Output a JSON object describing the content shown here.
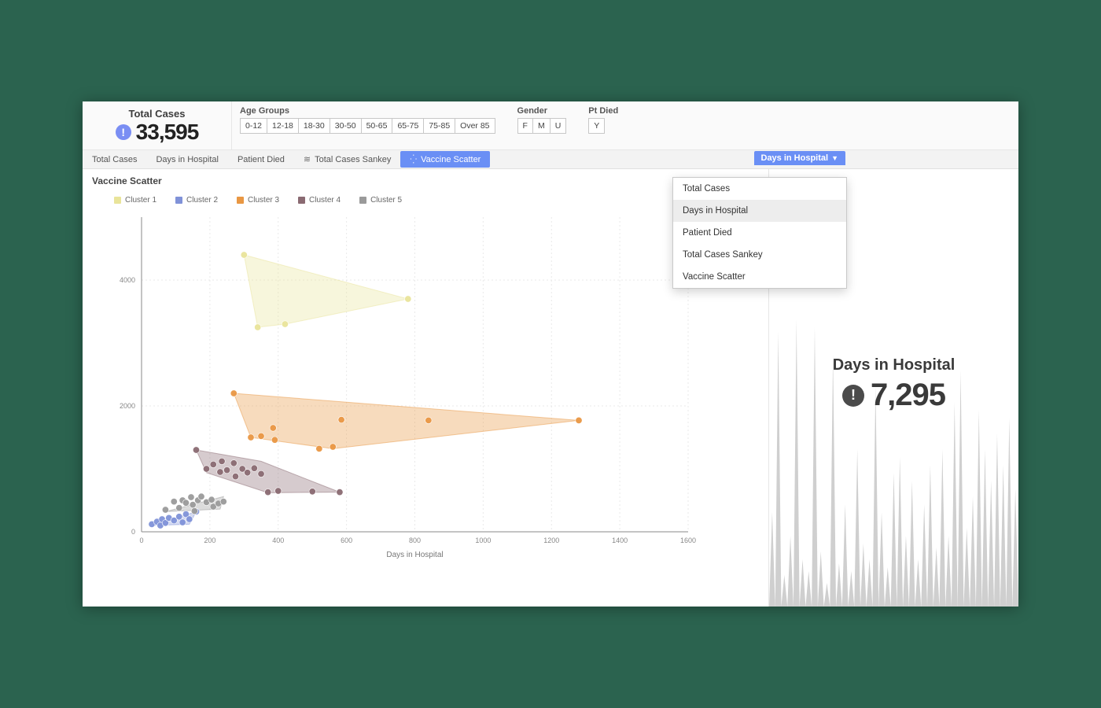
{
  "kpi_top": {
    "title": "Total Cases",
    "value": "33,595"
  },
  "filters": {
    "age_label": "Age Groups",
    "age_options": [
      "0-12",
      "12-18",
      "18-30",
      "30-50",
      "50-65",
      "65-75",
      "75-85",
      "Over 85"
    ],
    "gender_label": "Gender",
    "gender_options": [
      "F",
      "M",
      "U"
    ],
    "died_label": "Pt Died",
    "died_options": [
      "Y"
    ]
  },
  "tabs": {
    "items": [
      "Total Cases",
      "Days in Hospital",
      "Patient Died",
      "Total Cases Sankey",
      "Vaccine Scatter"
    ],
    "active_index": 4,
    "sankey_icon_index": 3,
    "scatter_icon_index": 4
  },
  "chart": {
    "title": "Vaccine Scatter",
    "xlabel": "Days in Hospital",
    "legend": [
      {
        "name": "Cluster 1",
        "color": "#e9e49a"
      },
      {
        "name": "Cluster 2",
        "color": "#8092d8"
      },
      {
        "name": "Cluster 3",
        "color": "#e99743"
      },
      {
        "name": "Cluster 4",
        "color": "#8a6a72"
      },
      {
        "name": "Cluster 5",
        "color": "#9a9a9a"
      }
    ]
  },
  "dropdown": {
    "button_label": "Days in Hospital",
    "items": [
      "Total Cases",
      "Days in Hospital",
      "Patient Died",
      "Total Cases Sankey",
      "Vaccine Scatter"
    ],
    "selected_index": 1
  },
  "side_kpi": {
    "title": "Days in Hospital",
    "value": "7,295"
  },
  "chart_data": {
    "type": "scatter",
    "title": "Vaccine Scatter",
    "xlabel": "Days in Hospital",
    "ylabel": "",
    "xlim": [
      0,
      1600
    ],
    "ylim": [
      0,
      5000
    ],
    "xticks": [
      0,
      200,
      400,
      600,
      800,
      1000,
      1200,
      1400,
      1600
    ],
    "yticks": [
      0,
      2000,
      4000
    ],
    "series": [
      {
        "name": "Cluster 1",
        "color": "#e9e49a",
        "points": [
          [
            300,
            4400
          ],
          [
            340,
            3250
          ],
          [
            420,
            3300
          ],
          [
            780,
            3700
          ]
        ],
        "hull": [
          [
            300,
            4400
          ],
          [
            780,
            3700
          ],
          [
            420,
            3300
          ],
          [
            340,
            3250
          ]
        ]
      },
      {
        "name": "Cluster 2",
        "color": "#8092d8",
        "points": [
          [
            30,
            120
          ],
          [
            45,
            160
          ],
          [
            55,
            100
          ],
          [
            60,
            200
          ],
          [
            70,
            140
          ],
          [
            80,
            220
          ],
          [
            95,
            180
          ],
          [
            110,
            240
          ],
          [
            120,
            150
          ],
          [
            130,
            280
          ],
          [
            140,
            200
          ],
          [
            160,
            320
          ]
        ],
        "hull": [
          [
            30,
            100
          ],
          [
            160,
            320
          ],
          [
            140,
            120
          ]
        ]
      },
      {
        "name": "Cluster 3",
        "color": "#e99743",
        "points": [
          [
            270,
            2200
          ],
          [
            320,
            1500
          ],
          [
            350,
            1520
          ],
          [
            385,
            1650
          ],
          [
            390,
            1460
          ],
          [
            520,
            1320
          ],
          [
            560,
            1350
          ],
          [
            585,
            1780
          ],
          [
            840,
            1770
          ],
          [
            1280,
            1770
          ]
        ],
        "hull": [
          [
            270,
            2200
          ],
          [
            1280,
            1770
          ],
          [
            560,
            1320
          ],
          [
            320,
            1500
          ]
        ]
      },
      {
        "name": "Cluster 4",
        "color": "#8a6a72",
        "points": [
          [
            160,
            1300
          ],
          [
            190,
            1000
          ],
          [
            210,
            1070
          ],
          [
            230,
            950
          ],
          [
            235,
            1120
          ],
          [
            250,
            980
          ],
          [
            270,
            1090
          ],
          [
            275,
            880
          ],
          [
            295,
            1000
          ],
          [
            310,
            940
          ],
          [
            330,
            1010
          ],
          [
            350,
            920
          ],
          [
            370,
            630
          ],
          [
            400,
            650
          ],
          [
            500,
            640
          ],
          [
            580,
            630
          ]
        ],
        "hull": [
          [
            160,
            1300
          ],
          [
            350,
            1120
          ],
          [
            580,
            630
          ],
          [
            370,
            620
          ],
          [
            190,
            940
          ]
        ]
      },
      {
        "name": "Cluster 5",
        "color": "#9a9a9a",
        "points": [
          [
            70,
            350
          ],
          [
            95,
            480
          ],
          [
            110,
            380
          ],
          [
            120,
            500
          ],
          [
            130,
            460
          ],
          [
            145,
            550
          ],
          [
            155,
            330
          ],
          [
            150,
            430
          ],
          [
            165,
            500
          ],
          [
            175,
            560
          ],
          [
            190,
            470
          ],
          [
            205,
            510
          ],
          [
            210,
            400
          ],
          [
            225,
            450
          ],
          [
            240,
            480
          ]
        ],
        "hull": [
          [
            70,
            320
          ],
          [
            240,
            560
          ],
          [
            230,
            360
          ]
        ]
      }
    ]
  }
}
